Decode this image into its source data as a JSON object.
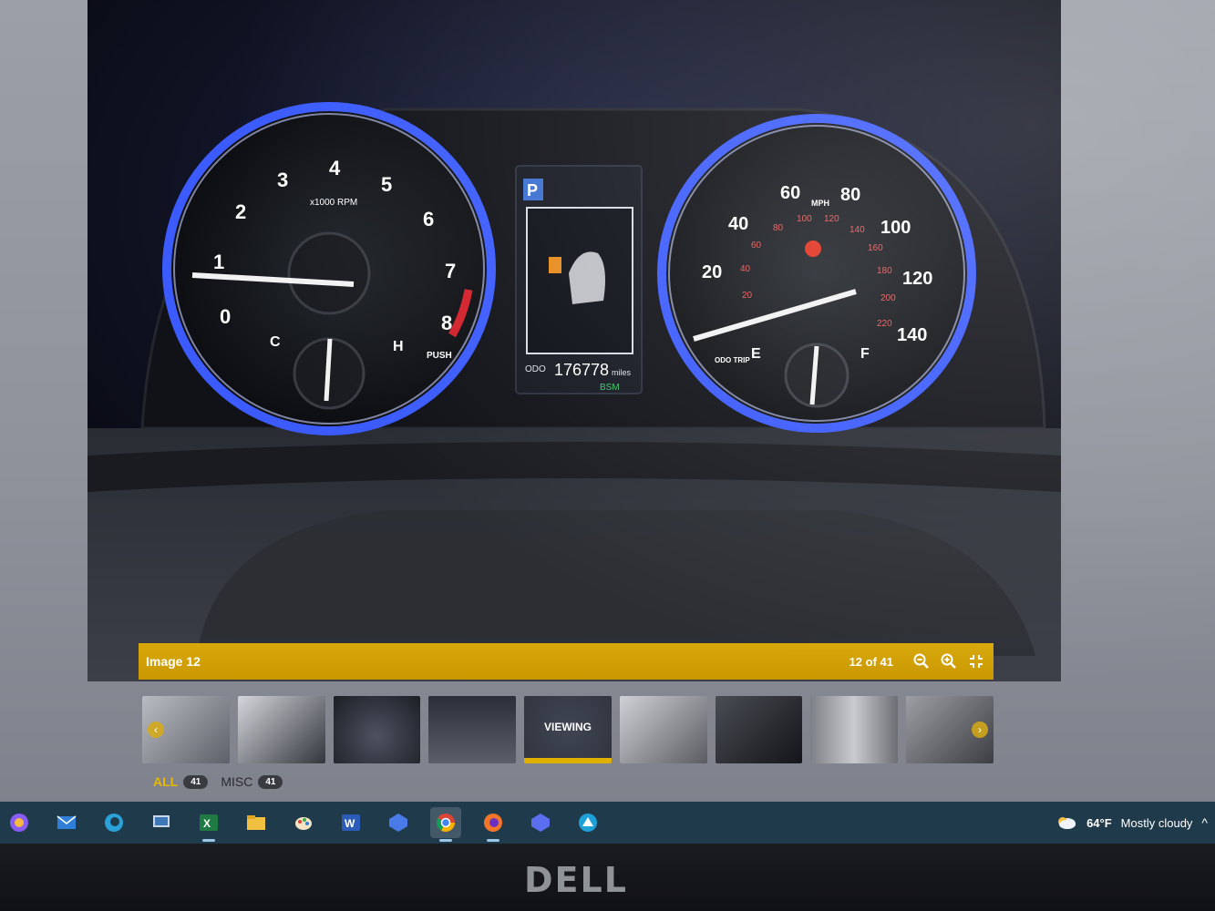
{
  "viewer": {
    "caption_title": "Image 12",
    "counter": "12 of 41",
    "zoom_out_icon": "zoom-out-icon",
    "zoom_in_icon": "zoom-in-icon",
    "collapse_icon": "collapse-icon",
    "viewing_label": "VIEWING"
  },
  "photo": {
    "tach_numbers": [
      "0",
      "1",
      "2",
      "3",
      "4",
      "5",
      "6",
      "7",
      "8"
    ],
    "tach_unit": "x1000 RPM",
    "temp_c": "C",
    "temp_h": "H",
    "push_label": "PUSH",
    "speed_numbers": [
      "20",
      "40",
      "60",
      "80",
      "100",
      "120",
      "140"
    ],
    "speed_unit": "MPH",
    "kmh_numbers": [
      "20",
      "40",
      "60",
      "80",
      "100",
      "120",
      "140",
      "160",
      "180",
      "200",
      "220"
    ],
    "fuel_e": "E",
    "fuel_f": "F",
    "odo_trip": "ODO TRIP",
    "display_gear": "P",
    "odo_label": "ODO",
    "odometer": "176778",
    "odo_unit": "miles",
    "bsm": "BSM"
  },
  "thumbnails": [
    {
      "name": "door-interior"
    },
    {
      "name": "door-panel"
    },
    {
      "name": "steering-wheel"
    },
    {
      "name": "dashboard"
    },
    {
      "name": "instrument-cluster",
      "active": true
    },
    {
      "name": "rear-seat"
    },
    {
      "name": "seats"
    },
    {
      "name": "undercarriage"
    },
    {
      "name": "engine"
    }
  ],
  "filters": [
    {
      "label": "ALL",
      "count": "41"
    },
    {
      "label": "MISC",
      "count": "41"
    }
  ],
  "taskbar": {
    "icons": [
      "copilot-icon",
      "mail-icon",
      "edge-icon",
      "remote-desktop-icon",
      "excel-icon",
      "file-explorer-icon",
      "paint-icon",
      "word-icon",
      "app-icon",
      "chrome-icon",
      "firefox-icon",
      "app-icon-2",
      "app-icon-3"
    ],
    "weather_temp": "64°F",
    "weather_desc": "Mostly cloudy"
  },
  "bezel_brand": "DELL",
  "colors": {
    "accent_gold": "#d8a80a",
    "gauge_blue": "#3b5bff",
    "taskbar": "#1f3a4a"
  }
}
